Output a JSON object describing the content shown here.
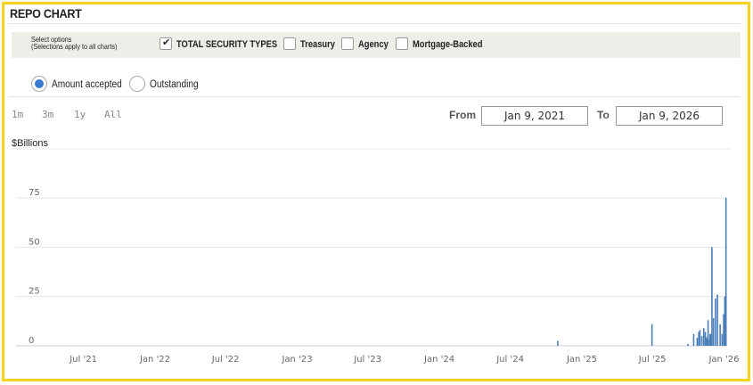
{
  "title": "REPO CHART",
  "options": {
    "note_line1": "Select options",
    "note_line2": "(Selections apply to all charts)",
    "checkboxes": [
      {
        "label": "TOTAL SECURITY TYPES",
        "checked": true
      },
      {
        "label": "Treasury",
        "checked": false
      },
      {
        "label": "Agency",
        "checked": false
      },
      {
        "label": "Mortgage-Backed",
        "checked": false
      }
    ]
  },
  "radios": [
    {
      "label": "Amount accepted",
      "selected": true
    },
    {
      "label": "Outstanding",
      "selected": false
    }
  ],
  "ranges": [
    "1m",
    "3m",
    "1y",
    "All"
  ],
  "date_range": {
    "from_label": "From",
    "from": "Jan 9, 2021",
    "to_label": "To",
    "to": "Jan 9, 2026"
  },
  "colors": {
    "accent": "#3a7ad0",
    "bar": "#4a7fb8",
    "frame": "#f6d21c"
  },
  "chart_data": {
    "type": "bar",
    "ylabel": "$Billions",
    "ylim": [
      0,
      75
    ],
    "yticks": [
      0,
      25,
      50,
      75
    ],
    "xlim": [
      "2021-01-09",
      "2026-01-09"
    ],
    "xticks": [
      {
        "date": "2021-07-01",
        "label": "Jul '21"
      },
      {
        "date": "2022-01-01",
        "label": "Jan '22"
      },
      {
        "date": "2022-07-01",
        "label": "Jul '22"
      },
      {
        "date": "2023-01-01",
        "label": "Jan '23"
      },
      {
        "date": "2023-07-01",
        "label": "Jul '23"
      },
      {
        "date": "2024-01-01",
        "label": "Jan '24"
      },
      {
        "date": "2024-07-01",
        "label": "Jul '24"
      },
      {
        "date": "2025-01-01",
        "label": "Jan '25"
      },
      {
        "date": "2025-07-01",
        "label": "Jul '25"
      },
      {
        "date": "2026-01-01",
        "label": "Jan '26"
      }
    ],
    "gridlines": true,
    "series": [
      {
        "points": [
          {
            "x": "2024-10-31",
            "y": 2.5
          },
          {
            "x": "2025-06-30",
            "y": 11
          },
          {
            "x": "2025-09-30",
            "y": 1
          },
          {
            "x": "2025-10-15",
            "y": 6
          },
          {
            "x": "2025-10-24",
            "y": 4
          },
          {
            "x": "2025-10-28",
            "y": 7
          },
          {
            "x": "2025-10-31",
            "y": 8
          },
          {
            "x": "2025-11-05",
            "y": 5
          },
          {
            "x": "2025-11-10",
            "y": 9
          },
          {
            "x": "2025-11-14",
            "y": 7
          },
          {
            "x": "2025-11-17",
            "y": 4
          },
          {
            "x": "2025-11-20",
            "y": 5
          },
          {
            "x": "2025-11-25",
            "y": 3
          },
          {
            "x": "2025-11-26",
            "y": 6
          },
          {
            "x": "2025-11-28",
            "y": 6
          },
          {
            "x": "2025-11-21",
            "y": 13
          },
          {
            "x": "2025-12-01",
            "y": 50
          },
          {
            "x": "2025-12-05",
            "y": 14
          },
          {
            "x": "2025-12-10",
            "y": 24
          },
          {
            "x": "2025-12-15",
            "y": 26
          },
          {
            "x": "2025-12-22",
            "y": 11
          },
          {
            "x": "2025-12-27",
            "y": 6
          },
          {
            "x": "2025-12-31",
            "y": 16
          },
          {
            "x": "2026-01-03",
            "y": 25
          },
          {
            "x": "2026-01-06",
            "y": 75
          }
        ]
      }
    ]
  }
}
